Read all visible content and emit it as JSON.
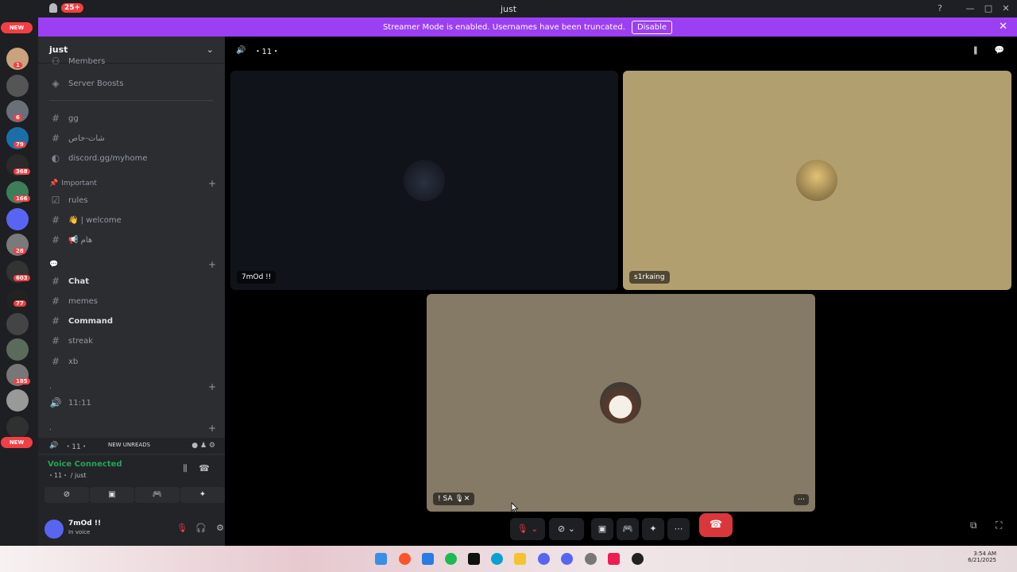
{
  "titlebar": {
    "title": "just",
    "badge": "25+",
    "help": "?",
    "minimize": "—",
    "maximize": "□",
    "close": "✕"
  },
  "banner": {
    "text": "Streamer Mode is enabled. Usernames have been truncated.",
    "disable": "Disable",
    "close": "✕"
  },
  "guilds": {
    "new_top": "NEW",
    "new_bottom": "NEW",
    "badges": [
      "1",
      "6",
      "79",
      "368",
      "166",
      "28",
      "603",
      "77",
      "185"
    ]
  },
  "sidebar": {
    "server_name": "just",
    "members": "Members",
    "server_boosts": "Server Boosts",
    "channels_top": [
      {
        "name": "gg"
      },
      {
        "name": "شات-خاص"
      },
      {
        "name": "discord.gg/myhome"
      }
    ],
    "cat_important": "Important",
    "channels_important": [
      {
        "name": "rules"
      },
      {
        "name": "👋 | welcome"
      },
      {
        "name": "📢 هام"
      }
    ],
    "cat_chat": "💬",
    "channels_chat": [
      {
        "name": "Chat"
      },
      {
        "name": "memes"
      },
      {
        "name": "Command"
      },
      {
        "name": "streak"
      },
      {
        "name": "xb"
      }
    ],
    "cat_dot": ".",
    "channel_voice": "11:11",
    "cat_dot2": "."
  },
  "voicebar": {
    "label": "・11・",
    "new_unreads": "NEW UNREADS"
  },
  "panel": {
    "status": "Voice Connected",
    "sub": "・11・ / just"
  },
  "user": {
    "name": "7mOd !!",
    "status": "In voice"
  },
  "main": {
    "channel": "・11・"
  },
  "tiles": [
    {
      "label": "7mOd !!"
    },
    {
      "label": "s1rkaing"
    },
    {
      "label": "! SA 🎙✕"
    }
  ],
  "taskbar": {
    "time": "3:54 AM",
    "date": "6/21/2025"
  },
  "colors": {
    "accent": "#9b3ff3",
    "danger": "#da373c",
    "online": "#23a55a"
  }
}
